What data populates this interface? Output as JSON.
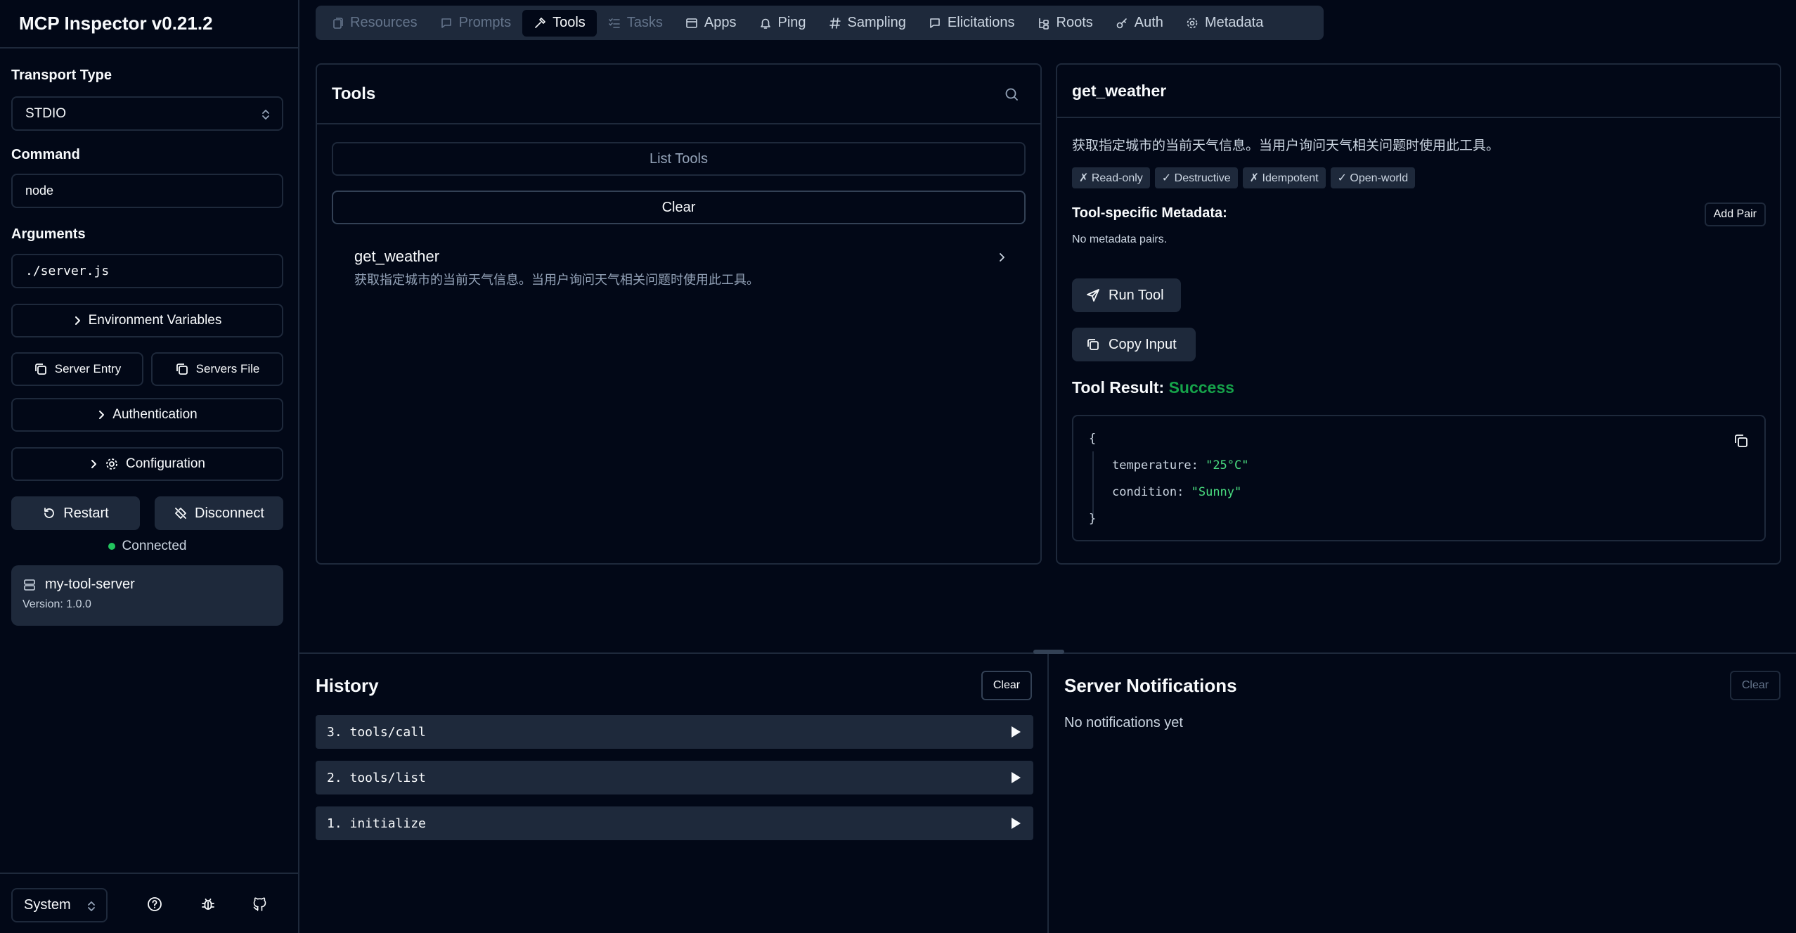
{
  "app": {
    "title": "MCP Inspector v0.21.2"
  },
  "sidebar": {
    "transport_label": "Transport Type",
    "transport_value": "STDIO",
    "command_label": "Command",
    "command_value": "node",
    "arguments_label": "Arguments",
    "arguments_value": "./server.js",
    "env_vars": "Environment Variables",
    "server_entry": "Server Entry",
    "servers_file": "Servers File",
    "authentication": "Authentication",
    "configuration": "Configuration",
    "restart": "Restart",
    "disconnect": "Disconnect",
    "status": "Connected",
    "server_name": "my-tool-server",
    "server_version": "Version: 1.0.0",
    "theme": "System"
  },
  "tabs": [
    {
      "label": "Resources",
      "icon": "resources-icon"
    },
    {
      "label": "Prompts",
      "icon": "prompts-icon"
    },
    {
      "label": "Tools",
      "icon": "hammer-icon"
    },
    {
      "label": "Tasks",
      "icon": "tasks-icon"
    },
    {
      "label": "Apps",
      "icon": "apps-icon"
    },
    {
      "label": "Ping",
      "icon": "bell-icon"
    },
    {
      "label": "Sampling",
      "icon": "hash-icon"
    },
    {
      "label": "Elicitations",
      "icon": "message-icon"
    },
    {
      "label": "Roots",
      "icon": "roots-icon"
    },
    {
      "label": "Auth",
      "icon": "key-icon"
    },
    {
      "label": "Metadata",
      "icon": "gear-icon"
    }
  ],
  "tools_panel": {
    "title": "Tools",
    "list_tools": "List Tools",
    "clear": "Clear",
    "items": [
      {
        "name": "get_weather",
        "description": "获取指定城市的当前天气信息。当用户询问天气相关问题时使用此工具。"
      }
    ]
  },
  "detail": {
    "title": "get_weather",
    "description": "获取指定城市的当前天气信息。当用户询问天气相关问题时使用此工具。",
    "annotations": [
      "✗ Read-only",
      "✓ Destructive",
      "✗ Idempotent",
      "✓ Open-world"
    ],
    "metadata_title": "Tool-specific Metadata:",
    "add_pair": "Add Pair",
    "no_metadata": "No metadata pairs.",
    "run_tool": "Run Tool",
    "copy_input": "Copy Input",
    "result_label": "Tool Result:",
    "result_status": "Success",
    "result": {
      "open": "{",
      "close": "}",
      "k1": "temperature:",
      "v1": "\"25°C\"",
      "k2": "condition:",
      "v2": "\"Sunny\""
    }
  },
  "history": {
    "title": "History",
    "clear": "Clear",
    "items": [
      "3. tools/call",
      "2. tools/list",
      "1. initialize"
    ]
  },
  "notifications": {
    "title": "Server Notifications",
    "clear": "Clear",
    "empty": "No notifications yet"
  },
  "colors": {
    "background": "#020817",
    "surface": "#1e293b",
    "success": "#16a34a",
    "json_string": "#4ade80",
    "connected": "#22c55e"
  }
}
